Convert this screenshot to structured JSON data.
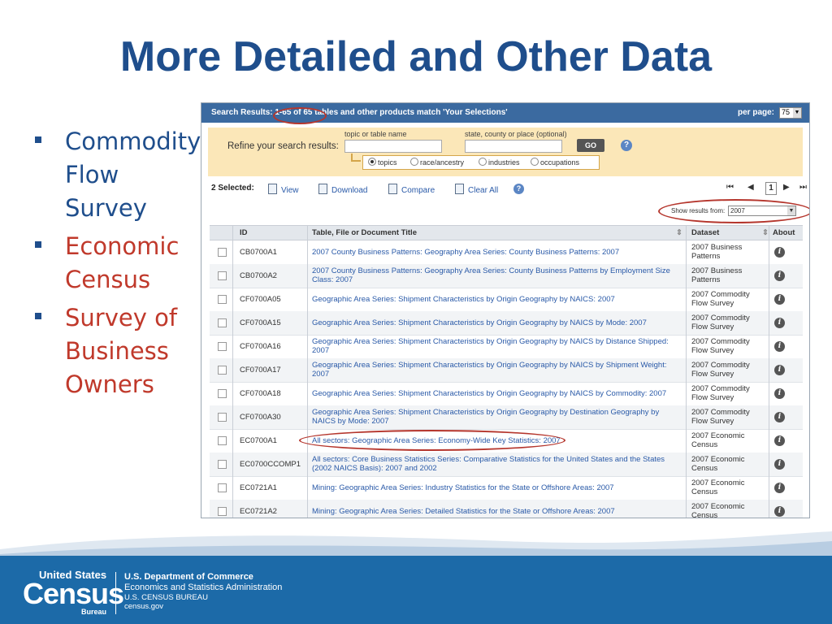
{
  "slide": {
    "title": "More Detailed and Other Data",
    "bullets": [
      {
        "text": "Commodity Flow Survey",
        "color": "#1f4e8c"
      },
      {
        "text": "Economic Census",
        "color": "#c0392b"
      },
      {
        "text": "Survey of Business Owners",
        "color": "#c0392b"
      }
    ]
  },
  "screenshot": {
    "search_results_text": "Search Results: 1-65 of 65 tables and other products match 'Your Selections'",
    "per_page_label": "per page:",
    "per_page_value": "75",
    "refine": {
      "label": "Refine your search results:",
      "topic_caption": "topic or table name",
      "place_caption": "state, county or place (optional)",
      "go_label": "GO",
      "help": "?",
      "radios": [
        {
          "label": "topics",
          "selected": true
        },
        {
          "label": "race/ancestry",
          "selected": false
        },
        {
          "label": "industries",
          "selected": false
        },
        {
          "label": "occupations",
          "selected": false
        }
      ]
    },
    "toolbar": {
      "selected": "2 Selected:",
      "view": "View",
      "download": "Download",
      "compare": "Compare",
      "clear_all": "Clear All",
      "help": "?"
    },
    "pager": {
      "first": "⏮",
      "prev": "◀",
      "page": "1",
      "next": "▶",
      "last": "⏭"
    },
    "show_results": {
      "label": "Show results from:",
      "value": "2007"
    },
    "table": {
      "headers": {
        "id": "ID",
        "title": "Table, File or Document Title",
        "dataset": "Dataset",
        "about": "About"
      },
      "rows": [
        {
          "id": "CB0700A1",
          "title": "2007 County Business Patterns: Geography Area Series: County Business Patterns: 2007",
          "dataset": "2007 Business Patterns"
        },
        {
          "id": "CB0700A2",
          "title": "2007 County Business Patterns: Geography Area Series: County Business Patterns by Employment Size Class: 2007",
          "dataset": "2007 Business Patterns"
        },
        {
          "id": "CF0700A05",
          "title": "Geographic Area Series: Shipment Characteristics by Origin Geography by NAICS: 2007",
          "dataset": "2007 Commodity Flow Survey"
        },
        {
          "id": "CF0700A15",
          "title": "Geographic Area Series: Shipment Characteristics by Origin Geography by NAICS by Mode: 2007",
          "dataset": "2007 Commodity Flow Survey"
        },
        {
          "id": "CF0700A16",
          "title": "Geographic Area Series: Shipment Characteristics by Origin Geography by NAICS by Distance Shipped: 2007",
          "dataset": "2007 Commodity Flow Survey"
        },
        {
          "id": "CF0700A17",
          "title": "Geographic Area Series: Shipment Characteristics by Origin Geography by NAICS by Shipment Weight: 2007",
          "dataset": "2007 Commodity Flow Survey"
        },
        {
          "id": "CF0700A18",
          "title": "Geographic Area Series: Shipment Characteristics by Origin Geography by NAICS by Commodity: 2007",
          "dataset": "2007 Commodity Flow Survey"
        },
        {
          "id": "CF0700A30",
          "title": "Geographic Area Series: Shipment Characteristics by Origin Geography by Destination Geography by NAICS by Mode: 2007",
          "dataset": "2007 Commodity Flow Survey"
        },
        {
          "id": "EC0700A1",
          "title": "All sectors: Geographic Area Series: Economy-Wide Key Statistics: 2007",
          "dataset": "2007 Economic Census"
        },
        {
          "id": "EC0700CCOMP1",
          "title": "All sectors: Core Business Statistics Series: Comparative Statistics for the United States and the States (2002 NAICS Basis): 2007 and 2002",
          "dataset": "2007 Economic Census"
        },
        {
          "id": "EC0721A1",
          "title": "Mining: Geographic Area Series: Industry Statistics for the State or Offshore Areas: 2007",
          "dataset": "2007 Economic Census"
        },
        {
          "id": "EC0721A2",
          "title": "Mining: Geographic Area Series: Detailed Statistics for the State or Offshore Areas: 2007",
          "dataset": "2007 Economic Census"
        }
      ],
      "info_glyph": "i"
    }
  },
  "footer": {
    "logo_top": "United States",
    "logo_main": "Census",
    "logo_sub": "Bureau",
    "line1": "U.S. Department of Commerce",
    "line2": "Economics and Statistics Administration",
    "line3": "U.S. CENSUS BUREAU",
    "line4": "census.gov"
  },
  "colors": {
    "title": "#1f4e8c",
    "accent_red": "#c0392b",
    "link": "#2a5aa8",
    "footer": "#1c6aa8"
  }
}
